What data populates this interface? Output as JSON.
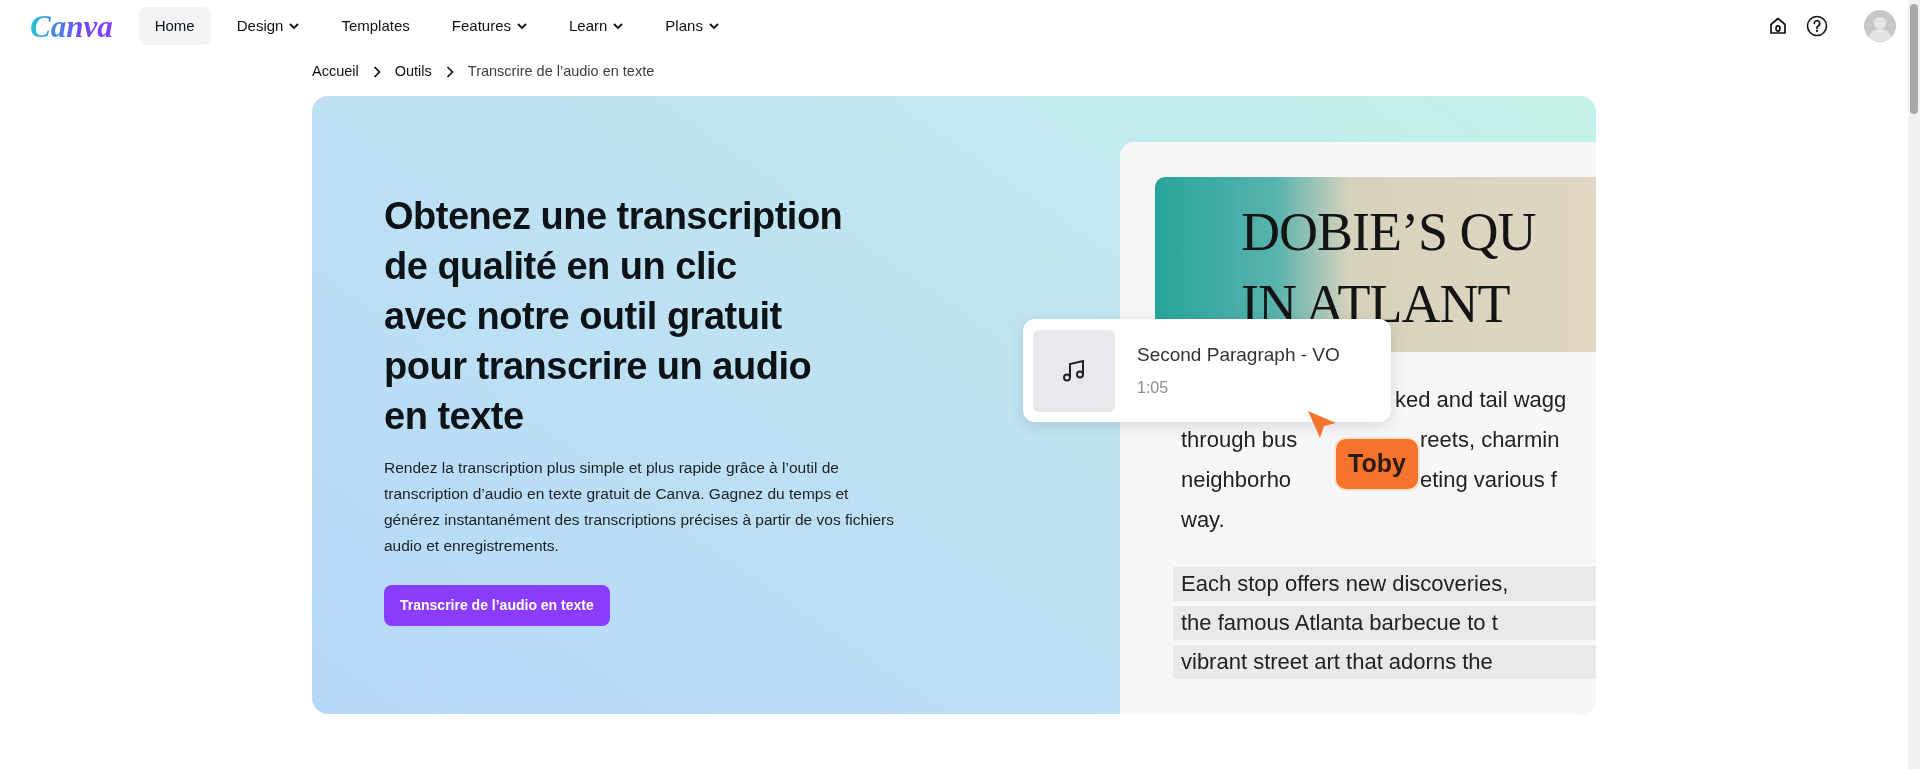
{
  "nav": {
    "logo": "Canva",
    "items": [
      {
        "label": "Home",
        "selected": true,
        "dropdown": false
      },
      {
        "label": "Design",
        "selected": false,
        "dropdown": true
      },
      {
        "label": "Templates",
        "selected": false,
        "dropdown": false
      },
      {
        "label": "Features",
        "selected": false,
        "dropdown": true
      },
      {
        "label": "Learn",
        "selected": false,
        "dropdown": true
      },
      {
        "label": "Plans",
        "selected": false,
        "dropdown": true
      }
    ]
  },
  "breadcrumb": [
    {
      "label": "Accueil",
      "current": false
    },
    {
      "label": "Outils",
      "current": false
    },
    {
      "label": "Transcrire de l’audio en texte",
      "current": true
    }
  ],
  "hero": {
    "title_lines": [
      "Obtenez une transcription",
      "de qualité en un clic",
      "avec notre outil gratuit",
      "pour transcrire un audio",
      "en texte"
    ],
    "description": "Rendez la transcription plus simple et plus rapide grâce à l’outil de transcription d’audio en texte gratuit de Canva. Gagnez du temps et générez instantanément des transcriptions précises à partir de vos fichiers audio et enregistrements.",
    "button": "Transcrire de l’audio en texte"
  },
  "illustration": {
    "banner_lines": [
      "DOBIE’S QU",
      "IN ATLANT"
    ],
    "audio_card": {
      "title": "Second Paragraph - VO",
      "duration": "1:05"
    },
    "cursor_label": "Toby",
    "paragraph_lines": [
      {
        "kind": "after-card",
        "parts": [
          "ked and tail wagg"
        ]
      },
      {
        "kind": "split",
        "parts": [
          "through bus",
          "reets, charmin"
        ]
      },
      {
        "kind": "split",
        "parts": [
          "neighborho",
          "eting various f"
        ]
      },
      {
        "kind": "plain",
        "parts": [
          "way."
        ]
      }
    ],
    "highlighted_lines": [
      "Each stop offers new discoveries,",
      "the famous Atlanta barbecue to t",
      "vibrant street art that adorns the"
    ]
  }
}
